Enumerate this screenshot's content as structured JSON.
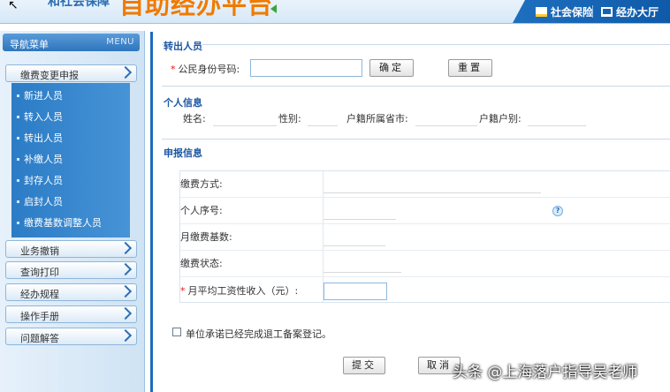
{
  "header": {
    "prefix": "和社会保障",
    "title": "自助经办平台",
    "tabs": [
      {
        "label": "社会保险"
      },
      {
        "label": "经办大厅"
      }
    ]
  },
  "sidebar": {
    "title": "导航菜单",
    "menu_label": "MENU",
    "groups": [
      {
        "label": "缴费变更申报"
      },
      {
        "label": "业务撤销"
      },
      {
        "label": "查询打印"
      },
      {
        "label": "经办规程"
      },
      {
        "label": "操作手册"
      },
      {
        "label": "问题解答"
      }
    ],
    "sub_items": [
      {
        "label": "新进人员"
      },
      {
        "label": "转入人员"
      },
      {
        "label": "转出人员"
      },
      {
        "label": "补缴人员"
      },
      {
        "label": "封存人员"
      },
      {
        "label": "启封人员"
      },
      {
        "label": "缴费基数调整人员"
      }
    ]
  },
  "transfer_out": {
    "title": "转出人员",
    "id_label": "公民身份号码:",
    "id_value": "",
    "confirm_label": "确定",
    "reset_label": "重置"
  },
  "personal_info": {
    "title": "个人信息",
    "name_label": "姓名:",
    "gender_label": "性别:",
    "province_label": "户籍所属省市:",
    "household_label": "户籍户别:"
  },
  "declaration": {
    "title": "申报信息",
    "method_label": "缴费方式:",
    "seq_label": "个人序号:",
    "base_label": "月缴费基数:",
    "status_label": "缴费状态:",
    "income_label": "月平均工资性收入（元）:",
    "income_value": ""
  },
  "pledge": {
    "label": "单位承诺已经完成退工备案登记。",
    "checked": false
  },
  "actions": {
    "submit_label": "提交",
    "cancel_label": "取消"
  },
  "watermark": "头条 @上海落户指导吴老师",
  "colors": {
    "accent": "#1d6bbd",
    "title_orange": "#f07a00",
    "section_title": "#1c57a2",
    "required": "#e01818"
  }
}
